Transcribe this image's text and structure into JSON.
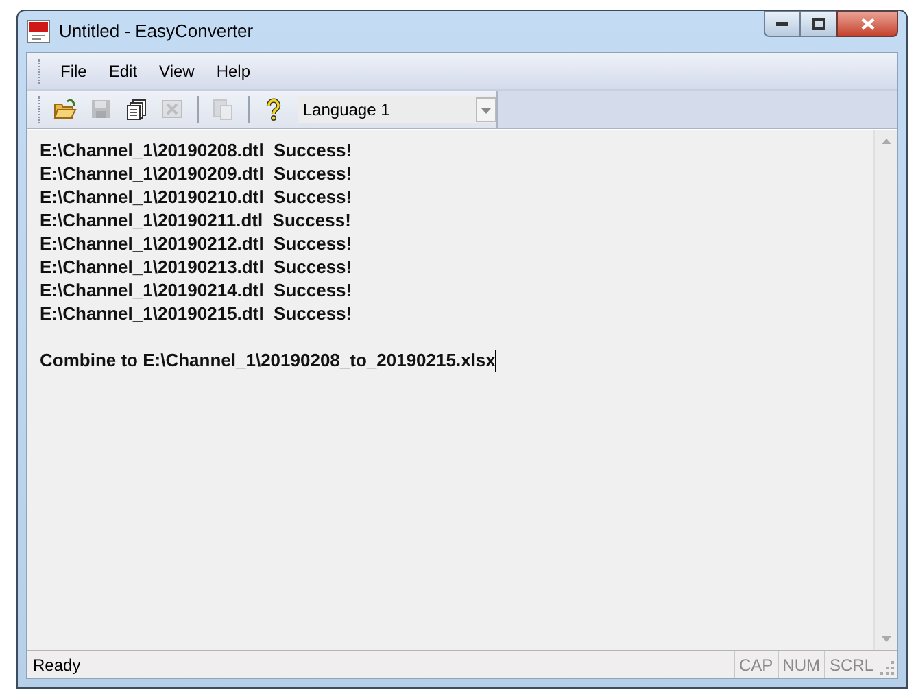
{
  "window": {
    "title": "Untitled - EasyConverter"
  },
  "menu": [
    "File",
    "Edit",
    "View",
    "Help"
  ],
  "toolbar": {
    "buttons": [
      {
        "kind": "open",
        "disabled": false
      },
      {
        "kind": "save",
        "disabled": true
      },
      {
        "kind": "copy",
        "disabled": false
      },
      {
        "kind": "delete",
        "disabled": true
      },
      {
        "kind": "separator"
      },
      {
        "kind": "paste",
        "disabled": true
      },
      {
        "kind": "separator"
      },
      {
        "kind": "help",
        "disabled": false
      }
    ],
    "language": {
      "value": "Language 1"
    }
  },
  "log": {
    "lines": [
      "E:\\Channel_1\\20190208.dtl  Success!",
      "E:\\Channel_1\\20190209.dtl  Success!",
      "E:\\Channel_1\\20190210.dtl  Success!",
      "E:\\Channel_1\\20190211.dtl  Success!",
      "E:\\Channel_1\\20190212.dtl  Success!",
      "E:\\Channel_1\\20190213.dtl  Success!",
      "E:\\Channel_1\\20190214.dtl  Success!",
      "E:\\Channel_1\\20190215.dtl  Success!"
    ],
    "result": "Combine to E:\\Channel_1\\20190208_to_20190215.xlsx"
  },
  "status_bar": {
    "text": "Ready",
    "indicators": [
      {
        "label": "CAP",
        "active": false
      },
      {
        "label": "NUM",
        "active": false
      },
      {
        "label": "SCRL",
        "active": false
      }
    ]
  }
}
